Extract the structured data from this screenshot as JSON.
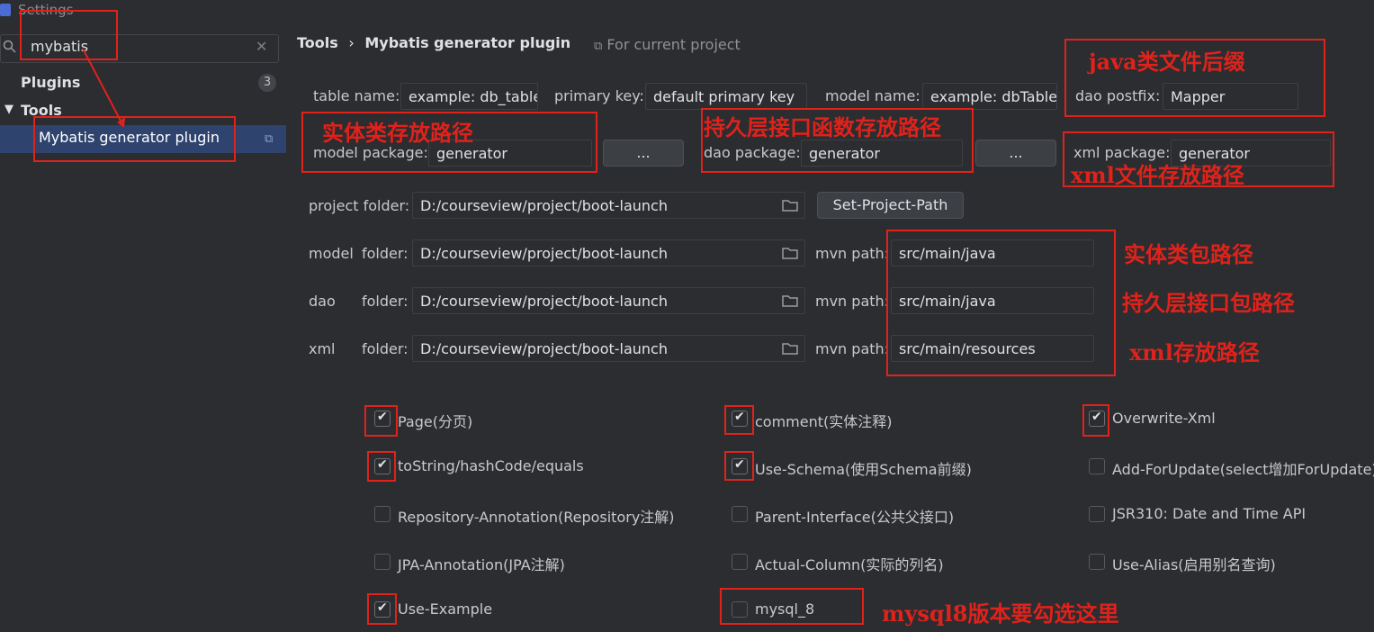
{
  "window": {
    "title": "Settings"
  },
  "search": {
    "value": "mybatis"
  },
  "tree": {
    "plugins_label": "Plugins",
    "plugins_count": "3",
    "tools_label": "Tools",
    "selected_item": "Mybatis generator plugin"
  },
  "header": {
    "breadcrumb_root": "Tools",
    "breadcrumb_sep": "›",
    "breadcrumb_page": "Mybatis generator plugin",
    "scope": "For current project"
  },
  "row1": {
    "table_label": "table name:",
    "table_value": "example: db_table",
    "pk_label": "primary key:",
    "pk_value": "default primary key",
    "model_label": "model name:",
    "model_value": "example: dbTable",
    "dao_postfix_label": "dao postfix:",
    "dao_postfix_value": "Mapper"
  },
  "row2": {
    "model_pkg_label": "model package:",
    "model_pkg_value": "generator",
    "browse1": "...",
    "dao_pkg_label": "dao package:",
    "dao_pkg_value": "generator",
    "browse2": "...",
    "xml_pkg_label": "xml package:",
    "xml_pkg_value": "generator"
  },
  "folders": {
    "project_label": "project folder:",
    "project_value": "D:/courseview/project/boot-launch",
    "set_path_button": "Set-Project-Path",
    "model_label_a": "model",
    "model_label_b": "folder:",
    "model_value": "D:/courseview/project/boot-launch",
    "dao_label_a": "dao",
    "dao_label_b": "folder:",
    "dao_value": "D:/courseview/project/boot-launch",
    "xml_label_a": "xml",
    "xml_label_b": "folder:",
    "xml_value": "D:/courseview/project/boot-launch",
    "mvn_label": "mvn path:",
    "model_mvn": "src/main/java",
    "dao_mvn": "src/main/java",
    "xml_mvn": "src/main/resources"
  },
  "options": {
    "page": "Page(分页)",
    "page_checked": true,
    "comment": "comment(实体注释)",
    "comment_checked": true,
    "overwrite_xml": "Overwrite-Xml",
    "overwrite_xml_checked": true,
    "tostring": "toString/hashCode/equals",
    "tostring_checked": true,
    "use_schema": "Use-Schema(使用Schema前缀)",
    "use_schema_checked": true,
    "add_for_update": "Add-ForUpdate(select增加ForUpdate)",
    "add_for_update_checked": false,
    "repo_annotation": "Repository-Annotation(Repository注解)",
    "repo_annotation_checked": false,
    "parent_interface": "Parent-Interface(公共父接口)",
    "parent_interface_checked": false,
    "jsr310": "JSR310: Date and Time API",
    "jsr310_checked": false,
    "jpa_annotation": "JPA-Annotation(JPA注解)",
    "jpa_annotation_checked": false,
    "actual_column": "Actual-Column(实际的列名)",
    "actual_column_checked": false,
    "use_alias": "Use-Alias(启用别名查询)",
    "use_alias_checked": false,
    "use_example": "Use-Example",
    "use_example_checked": true,
    "mysql8": "mysql_8",
    "mysql8_checked": false
  },
  "annotations": {
    "java_suffix": "java类文件后缀",
    "entity_path": "实体类存放路径",
    "dao_path": "持久层接口函数存放路径",
    "xml_path": "xml文件存放路径",
    "entity_pkg_path": "实体类包路径",
    "dao_pkg_path": "持久层接口包路径",
    "xml_store_path": "xml存放路径",
    "mysql8_note": "mysql8版本要勾选这里"
  },
  "colors": {
    "accent": "#2e436e",
    "annotation_red": "#e0221b",
    "background": "#2b2d30"
  }
}
